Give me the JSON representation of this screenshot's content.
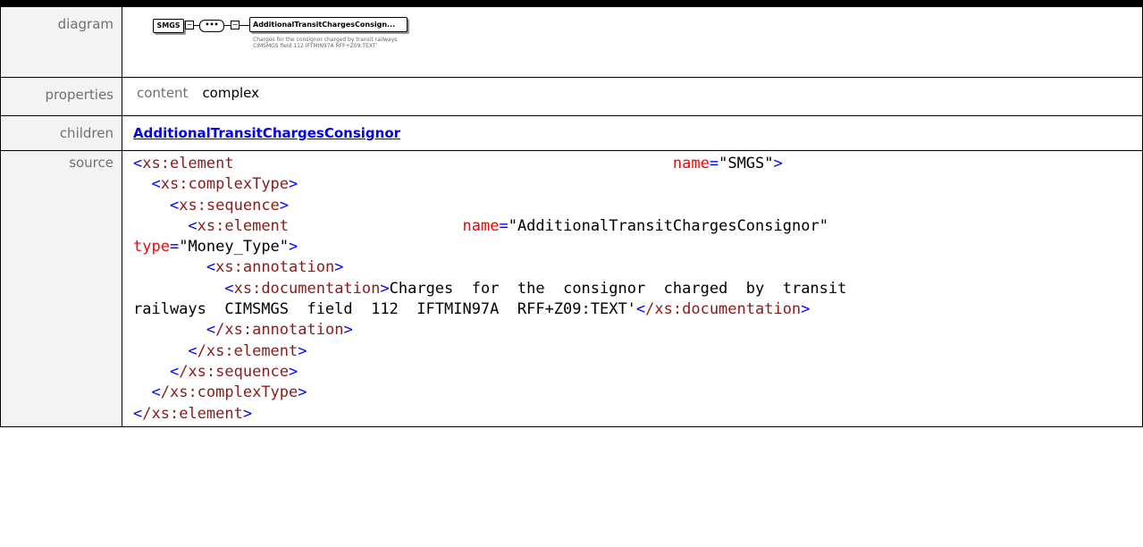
{
  "header": {
    "fragment": ""
  },
  "labels": {
    "diagram": "diagram",
    "properties": "properties",
    "children": "children",
    "source": "source"
  },
  "diagram": {
    "element": "SMGS",
    "sequence_symbol": "•••",
    "child": "AdditionalTransitChargesConsign...",
    "annotation": "Charges for the consignor charged by transit railways CIMSMGS field 112 IFTMIN97A RFF+Z09:TEXT'"
  },
  "properties": {
    "key": "content",
    "value": "complex"
  },
  "children": {
    "link": "AdditionalTransitChargesConsignor"
  },
  "source": {
    "l1_tag": "xs:element",
    "l1_attr": "name",
    "l1_val": "\"SMGS\"",
    "l2_tag": "xs:complexType",
    "l3_tag": "xs:sequence",
    "l4_tag": "xs:element",
    "l4_attr": "name",
    "l4_val": "\"AdditionalTransitChargesConsignor\"",
    "l5_attr": "type",
    "l5_val": "\"Money_Type\"",
    "l6_tag": "xs:annotation",
    "l7_tag": "xs:documentation",
    "l7_text": "Charges  for  the  consignor  charged  by  transit",
    "l8_text": "railways  CIMSMGS  field  112  IFTMIN97A  RFF+Z09:TEXT'",
    "l8_close": "/xs:documentation",
    "l9_close": "/xs:annotation",
    "l10_close": "/xs:element",
    "l11_close": "/xs:sequence",
    "l12_close": "/xs:complexType",
    "l13_close": "/xs:element"
  }
}
